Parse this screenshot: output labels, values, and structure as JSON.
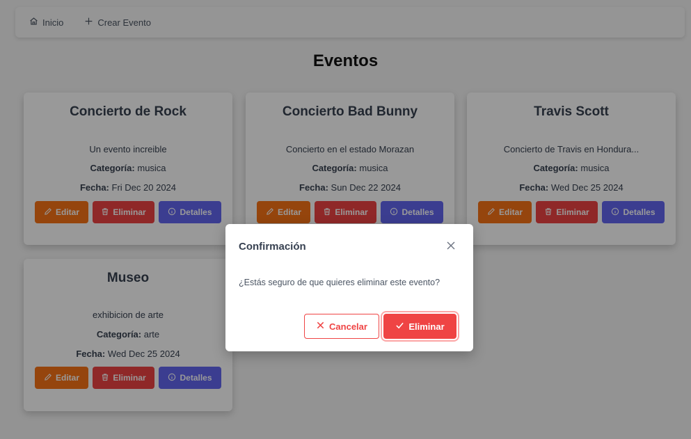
{
  "nav": {
    "home_label": "Inicio",
    "create_label": "Crear Evento"
  },
  "page": {
    "title": "Eventos"
  },
  "labels": {
    "category": "Categoría:",
    "date": "Fecha:",
    "edit": "Editar",
    "delete": "Eliminar",
    "details": "Detalles"
  },
  "events": [
    {
      "title": "Concierto de Rock",
      "description": "Un evento increible",
      "category": "musica",
      "date": "Fri Dec 20 2024"
    },
    {
      "title": "Concierto Bad Bunny",
      "description": "Concierto en el estado Morazan",
      "category": "musica",
      "date": "Sun Dec 22 2024"
    },
    {
      "title": "Travis Scott",
      "description": "Concierto de Travis en Hondura...",
      "category": "musica",
      "date": "Wed Dec 25 2024"
    },
    {
      "title": "Museo",
      "description": "exhibicion de arte",
      "category": "arte",
      "date": "Wed Dec 25 2024"
    }
  ],
  "dialog": {
    "title": "Confirmación",
    "message": "¿Estás seguro de que quieres eliminar este evento?",
    "cancel_label": "Cancelar",
    "confirm_label": "Eliminar"
  },
  "colors": {
    "edit": "#f97316",
    "delete": "#ef4444",
    "details": "#6366f1"
  },
  "icons": {
    "home": "home-icon",
    "create": "plus-icon",
    "edit": "pencil-icon",
    "delete": "trash-icon",
    "details": "info-icon",
    "close": "close-icon",
    "cancel": "x-icon",
    "confirm": "check-icon"
  }
}
